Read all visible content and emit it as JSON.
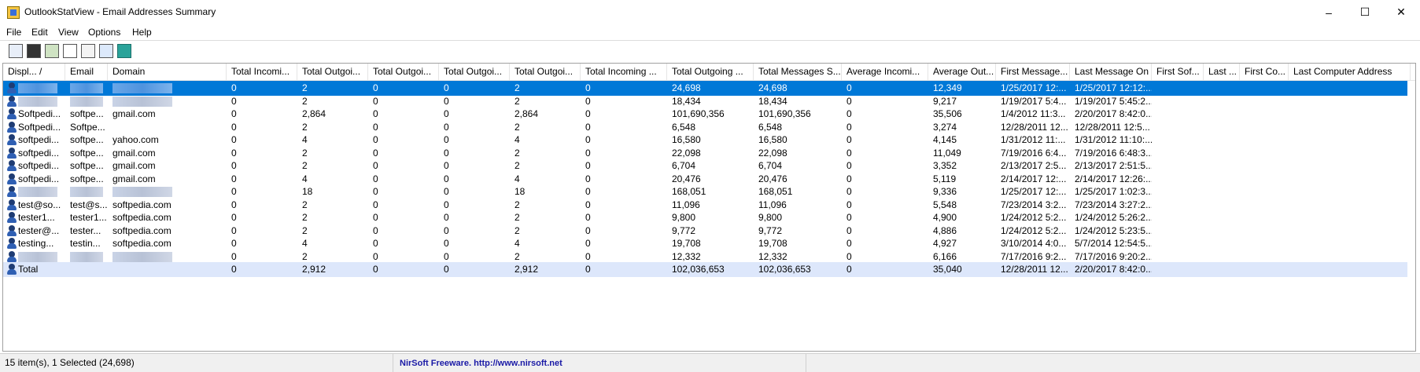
{
  "window": {
    "title": "OutlookStatView  -  Email Addresses Summary",
    "minimize_glyph": "–",
    "maximize_glyph": "☐",
    "close_glyph": "✕"
  },
  "menu": [
    "File",
    "Edit",
    "View",
    "Options",
    "Help"
  ],
  "toolbar_icons": [
    "properties-icon",
    "save-icon",
    "refresh-icon",
    "copy-icon",
    "html-report-icon",
    "find-icon",
    "exit-icon"
  ],
  "columns": [
    "Displ...  /",
    "Email",
    "Domain",
    "Total Incomi...",
    "Total Outgoi...",
    "Total Outgoi...",
    "Total Outgoi...",
    "Total Outgoi...",
    "Total Incoming ...",
    "Total Outgoing ...",
    "Total Messages S...",
    "Average Incomi...",
    "Average Out...",
    "First Message...",
    "Last Message On",
    "First Sof...",
    "Last ...",
    "First Co...",
    "Last Computer Address"
  ],
  "rows": [
    {
      "display": "",
      "email": "",
      "domain": "",
      "c3": "0",
      "c4": "2",
      "c5": "0",
      "c6": "0",
      "c7": "2",
      "c8": "0",
      "c9": "24,698",
      "c10": "24,698",
      "c11": "0",
      "c12": "12,349",
      "c13": "1/25/2017 12:...",
      "c14": "1/25/2017 12:12:...",
      "selected": true,
      "redacted": true
    },
    {
      "display": "",
      "email": "",
      "domain": "",
      "c3": "0",
      "c4": "2",
      "c5": "0",
      "c6": "0",
      "c7": "2",
      "c8": "0",
      "c9": "18,434",
      "c10": "18,434",
      "c11": "0",
      "c12": "9,217",
      "c13": "1/19/2017 5:4...",
      "c14": "1/19/2017 5:45:2...",
      "redacted": true
    },
    {
      "display": "Softpedi...",
      "email": "softpe...",
      "domain": "gmail.com",
      "c3": "0",
      "c4": "2,864",
      "c5": "0",
      "c6": "0",
      "c7": "2,864",
      "c8": "0",
      "c9": "101,690,356",
      "c10": "101,690,356",
      "c11": "0",
      "c12": "35,506",
      "c13": "1/4/2012 11:3...",
      "c14": "2/20/2017 8:42:0..."
    },
    {
      "display": "Softpedi...",
      "email": "Softpe...",
      "domain": "",
      "c3": "0",
      "c4": "2",
      "c5": "0",
      "c6": "0",
      "c7": "2",
      "c8": "0",
      "c9": "6,548",
      "c10": "6,548",
      "c11": "0",
      "c12": "3,274",
      "c13": "12/28/2011 12...",
      "c14": "12/28/2011 12:5..."
    },
    {
      "display": "softpedi...",
      "email": "softpe...",
      "domain": "yahoo.com",
      "c3": "0",
      "c4": "4",
      "c5": "0",
      "c6": "0",
      "c7": "4",
      "c8": "0",
      "c9": "16,580",
      "c10": "16,580",
      "c11": "0",
      "c12": "4,145",
      "c13": "1/31/2012 11:...",
      "c14": "1/31/2012 11:10:..."
    },
    {
      "display": "softpedi...",
      "email": "softpe...",
      "domain": "gmail.com",
      "c3": "0",
      "c4": "2",
      "c5": "0",
      "c6": "0",
      "c7": "2",
      "c8": "0",
      "c9": "22,098",
      "c10": "22,098",
      "c11": "0",
      "c12": "11,049",
      "c13": "7/19/2016 6:4...",
      "c14": "7/19/2016 6:48:3..."
    },
    {
      "display": "softpedi...",
      "email": "softpe...",
      "domain": "gmail.com",
      "c3": "0",
      "c4": "2",
      "c5": "0",
      "c6": "0",
      "c7": "2",
      "c8": "0",
      "c9": "6,704",
      "c10": "6,704",
      "c11": "0",
      "c12": "3,352",
      "c13": "2/13/2017 2:5...",
      "c14": "2/13/2017 2:51:5..."
    },
    {
      "display": "softpedi...",
      "email": "softpe...",
      "domain": "gmail.com",
      "c3": "0",
      "c4": "4",
      "c5": "0",
      "c6": "0",
      "c7": "4",
      "c8": "0",
      "c9": "20,476",
      "c10": "20,476",
      "c11": "0",
      "c12": "5,119",
      "c13": "2/14/2017 12:...",
      "c14": "2/14/2017 12:26:..."
    },
    {
      "display": "",
      "email": "",
      "domain": "",
      "c3": "0",
      "c4": "18",
      "c5": "0",
      "c6": "0",
      "c7": "18",
      "c8": "0",
      "c9": "168,051",
      "c10": "168,051",
      "c11": "0",
      "c12": "9,336",
      "c13": "1/25/2017 12:...",
      "c14": "1/25/2017 1:02:3...",
      "redacted": true
    },
    {
      "display": "test@so...",
      "email": "test@s...",
      "domain": "softpedia.com",
      "c3": "0",
      "c4": "2",
      "c5": "0",
      "c6": "0",
      "c7": "2",
      "c8": "0",
      "c9": "11,096",
      "c10": "11,096",
      "c11": "0",
      "c12": "5,548",
      "c13": "7/23/2014 3:2...",
      "c14": "7/23/2014 3:27:2..."
    },
    {
      "display": "tester1...",
      "email": "tester1...",
      "domain": "softpedia.com",
      "c3": "0",
      "c4": "2",
      "c5": "0",
      "c6": "0",
      "c7": "2",
      "c8": "0",
      "c9": "9,800",
      "c10": "9,800",
      "c11": "0",
      "c12": "4,900",
      "c13": "1/24/2012 5:2...",
      "c14": "1/24/2012 5:26:2..."
    },
    {
      "display": "tester@...",
      "email": "tester...",
      "domain": "softpedia.com",
      "c3": "0",
      "c4": "2",
      "c5": "0",
      "c6": "0",
      "c7": "2",
      "c8": "0",
      "c9": "9,772",
      "c10": "9,772",
      "c11": "0",
      "c12": "4,886",
      "c13": "1/24/2012 5:2...",
      "c14": "1/24/2012 5:23:5..."
    },
    {
      "display": "testing...",
      "email": "testin...",
      "domain": "softpedia.com",
      "c3": "0",
      "c4": "4",
      "c5": "0",
      "c6": "0",
      "c7": "4",
      "c8": "0",
      "c9": "19,708",
      "c10": "19,708",
      "c11": "0",
      "c12": "4,927",
      "c13": "3/10/2014 4:0...",
      "c14": "5/7/2014 12:54:5..."
    },
    {
      "display": "",
      "email": "",
      "domain": "",
      "c3": "0",
      "c4": "2",
      "c5": "0",
      "c6": "0",
      "c7": "2",
      "c8": "0",
      "c9": "12,332",
      "c10": "12,332",
      "c11": "0",
      "c12": "6,166",
      "c13": "7/17/2016 9:2...",
      "c14": "7/17/2016 9:20:2...",
      "redacted": true
    },
    {
      "display": "Total",
      "email": "",
      "domain": "",
      "c3": "0",
      "c4": "2,912",
      "c5": "0",
      "c6": "0",
      "c7": "2,912",
      "c8": "0",
      "c9": "102,036,653",
      "c10": "102,036,653",
      "c11": "0",
      "c12": "35,040",
      "c13": "12/28/2011 12...",
      "c14": "2/20/2017 8:42:0...",
      "total": true
    }
  ],
  "status": {
    "items": "15 item(s), 1 Selected (24,698)",
    "link": "NirSoft Freeware.  http://www.nirsoft.net"
  },
  "colors": {
    "selection": "#0078d7",
    "total_row": "#dde7fb",
    "link": "#1a1aa6"
  }
}
